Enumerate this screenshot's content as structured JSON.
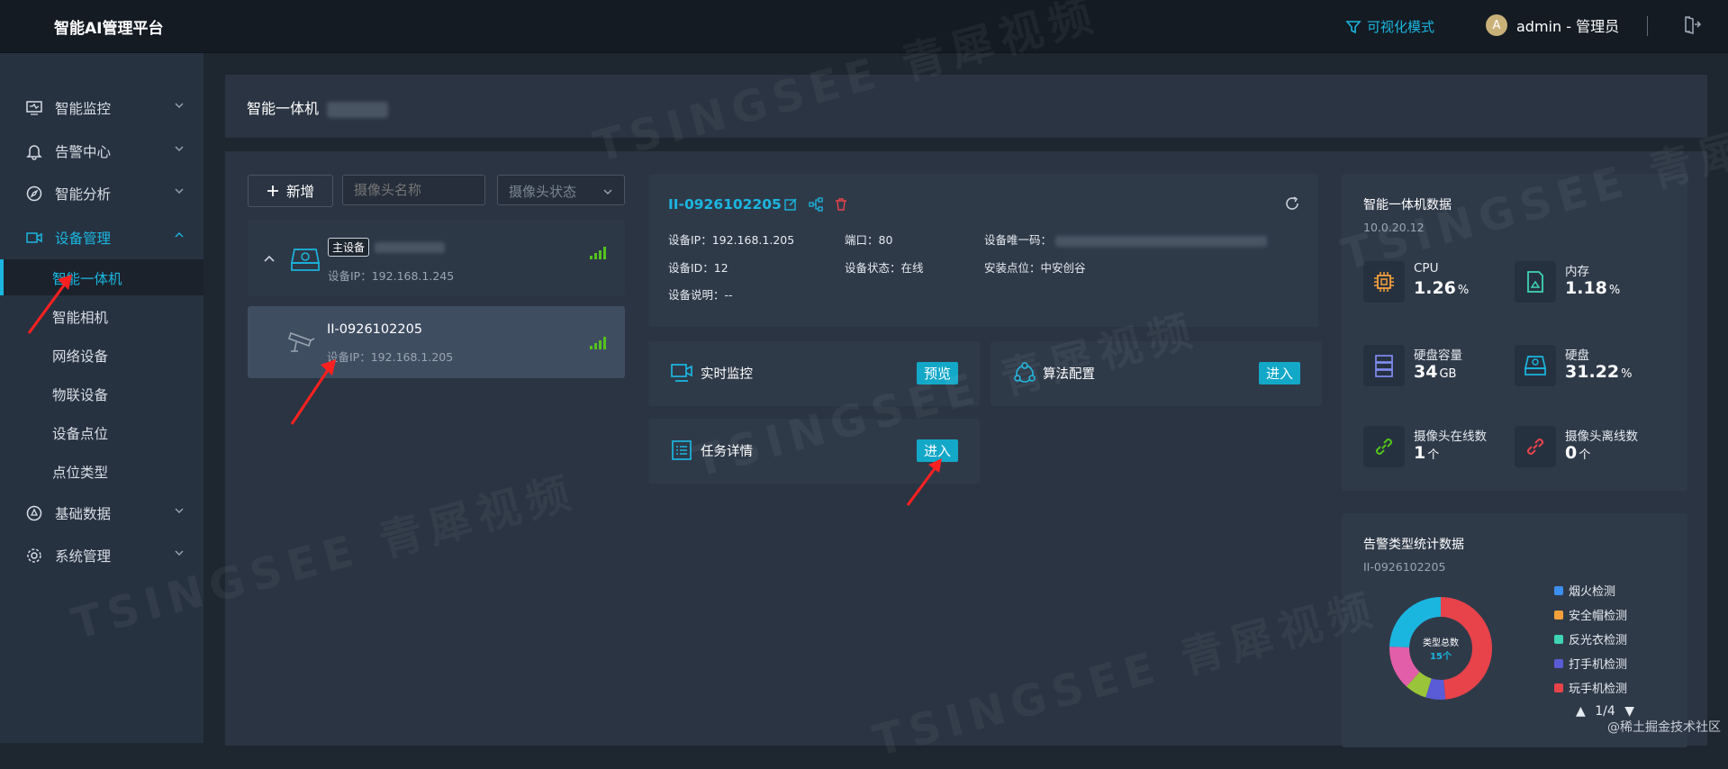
{
  "app": {
    "title": "智能AI管理平台",
    "viz_mode": "可视化模式",
    "user_avatar": "A",
    "user": "admin - 管理员"
  },
  "sidebar": {
    "items": [
      {
        "label": "智能监控",
        "icon": "monitor-icon"
      },
      {
        "label": "告警中心",
        "icon": "bell-icon"
      },
      {
        "label": "智能分析",
        "icon": "compass-icon"
      },
      {
        "label": "设备管理",
        "icon": "camera-device-icon",
        "active": true
      },
      {
        "label": "基础数据",
        "icon": "data-icon"
      },
      {
        "label": "系统管理",
        "icon": "gear-icon"
      }
    ],
    "sub_items": [
      {
        "label": "智能一体机",
        "active": true
      },
      {
        "label": "智能相机"
      },
      {
        "label": "网络设备"
      },
      {
        "label": "物联设备"
      },
      {
        "label": "设备点位"
      },
      {
        "label": "点位类型"
      }
    ]
  },
  "breadcrumb": {
    "title": "智能一体机"
  },
  "toolbar": {
    "add_label": "新增",
    "camera_name_placeholder": "摄像头名称",
    "camera_status_placeholder": "摄像头状态"
  },
  "devices": [
    {
      "tag": "主设备",
      "ip_label": "设备IP：",
      "ip": "192.168.1.245"
    },
    {
      "name": "II-0926102205",
      "ip_label": "设备IP：",
      "ip": "192.168.1.205"
    }
  ],
  "device_info": {
    "name": "II-0926102205",
    "ip": "设备IP：192.168.1.205",
    "port": "端口：80",
    "uid_label": "设备唯一码：",
    "id": "设备ID：12",
    "status": "设备状态：在线",
    "location": "安装点位：中安创谷",
    "desc": "设备说明：--"
  },
  "features": [
    {
      "label": "实时监控",
      "button": "预览"
    },
    {
      "label": "算法配置",
      "button": "进入"
    },
    {
      "label": "任务详情",
      "button": "进入"
    }
  ],
  "stats": {
    "title": "智能一体机数据",
    "version": "10.0.20.12",
    "items": [
      {
        "label": "CPU",
        "value": "1.26",
        "unit": "%",
        "icon": "cpu-icon"
      },
      {
        "label": "内存",
        "value": "1.18",
        "unit": "%",
        "icon": "memory-card-icon"
      },
      {
        "label": "硬盘容量",
        "value": "34",
        "unit": "GB",
        "icon": "server-icon"
      },
      {
        "label": "硬盘",
        "value": "31.22",
        "unit": "%",
        "icon": "disk-icon"
      },
      {
        "label": "摄像头在线数",
        "value": "1",
        "unit": "个",
        "icon": "link-icon"
      },
      {
        "label": "摄像头离线数",
        "value": "0",
        "unit": "个",
        "icon": "broken-link-icon"
      }
    ]
  },
  "alarm_stats": {
    "title": "告警类型统计数据",
    "device": "II-0926102205",
    "center_label": "类型总数",
    "center_value": "15个",
    "legend": [
      {
        "label": "烟火检测",
        "color": "#3d8ef0"
      },
      {
        "label": "安全帽检测",
        "color": "#f5a03b"
      },
      {
        "label": "反光衣检测",
        "color": "#3fd4b4"
      },
      {
        "label": "打手机检测",
        "color": "#5a5bd6"
      },
      {
        "label": "玩手机检测",
        "color": "#e8434a"
      }
    ],
    "pager": "1/4"
  },
  "watermark": "TSINGSEE 青犀视频",
  "footer_credit": "@稀土掘金技术社区",
  "colors": {
    "accent": "#1bb6e0",
    "button": "#13a8c8",
    "signal": "#52c41a",
    "arrow": "#ff2020"
  }
}
